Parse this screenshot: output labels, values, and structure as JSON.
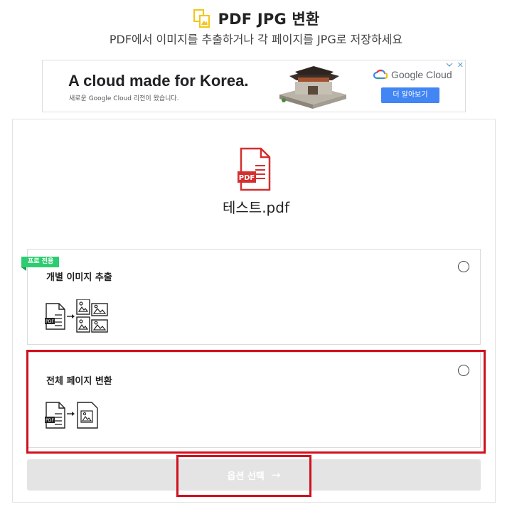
{
  "header": {
    "title": "PDF JPG 변환",
    "subtitle": "PDF에서 이미지를 추출하거나 각 페이지를 JPG로 저장하세요",
    "icon": "pdf-jpg-convert-icon",
    "icon_color": "#f5c518"
  },
  "ad": {
    "headline": "A cloud made for Korea.",
    "subtext": "새로운 Google Cloud 리전이 왔습니다.",
    "brand": "Google Cloud",
    "cta_label": "더 알아보기",
    "info_icon": "info-icon",
    "close_label": "✕"
  },
  "file": {
    "badge": "PDF",
    "name": "테스트.pdf",
    "icon_color": "#d32f2f"
  },
  "options": [
    {
      "label": "개별 이미지 추출",
      "badge": "프로 전용",
      "illustration": "pdf-to-multiple-images-icon",
      "selected": false
    },
    {
      "label": "전체 페이지 변환",
      "illustration": "pdf-to-single-image-icon",
      "selected": false
    }
  ],
  "submit": {
    "label": "옵션 선택",
    "arrow": "→",
    "enabled": false
  },
  "colors": {
    "highlight": "#d0101d",
    "pro_badge": "#2ecc71",
    "disabled_button": "#e4e4e4"
  }
}
